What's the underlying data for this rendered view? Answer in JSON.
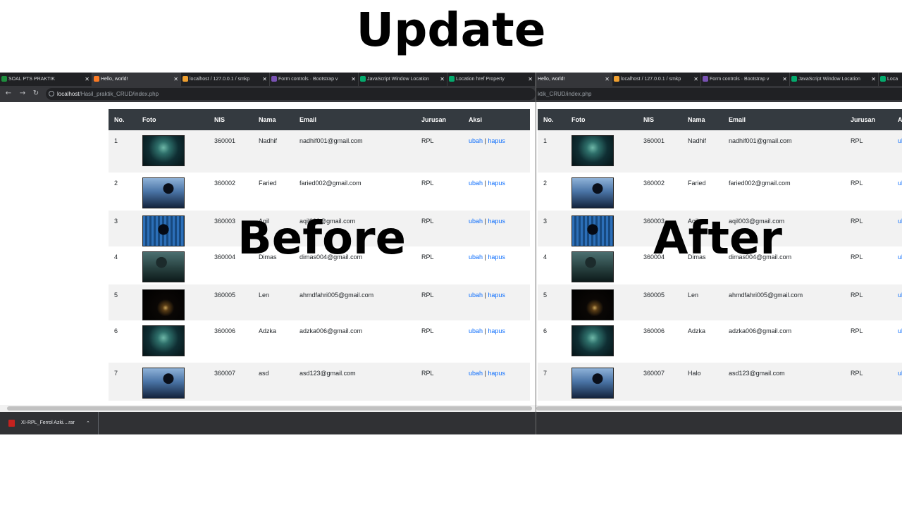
{
  "heading": "Update",
  "labels": {
    "before": "Before",
    "after": "After"
  },
  "colors": {
    "header_bg": "#343a40",
    "link": "#0d6efd",
    "stripe": "#f2f2f2",
    "browser_dark": "#202124"
  },
  "before": {
    "tabs": [
      {
        "title": "SOAL PTS PRAKTIK",
        "icon": "classroom-icon"
      },
      {
        "title": "Hello, world!",
        "icon": "xampp-icon",
        "active": true
      },
      {
        "title": "localhost / 127.0.0.1 / smkp",
        "icon": "phpmyadmin-icon"
      },
      {
        "title": "Form controls · Bootstrap v",
        "icon": "bootstrap-icon"
      },
      {
        "title": "JavaScript Window Location",
        "icon": "w3schools-icon"
      },
      {
        "title": "Location href Property",
        "icon": "w3schools-icon"
      }
    ],
    "url": {
      "host": "localhost",
      "path": "/Hasil_praktik_CRUD/index.php"
    }
  },
  "after": {
    "tabs": [
      {
        "title": "Hello, world!",
        "icon": "xampp-icon",
        "active": true
      },
      {
        "title": "localhost / 127.0.0.1 / smkp",
        "icon": "phpmyadmin-icon"
      },
      {
        "title": "Form controls · Bootstrap v",
        "icon": "bootstrap-icon"
      },
      {
        "title": "JavaScript Window Location",
        "icon": "w3schools-icon"
      },
      {
        "title": "Loca",
        "icon": "w3schools-icon"
      }
    ],
    "url": {
      "path": "ktik_CRUD/index.php"
    }
  },
  "table": {
    "headers": [
      "No.",
      "Foto",
      "NIS",
      "Nama",
      "Email",
      "Jurusan",
      "Aksi"
    ],
    "action_edit": "ubah",
    "action_sep": "|",
    "action_delete": "hapus"
  },
  "rows_before": [
    {
      "no": "1",
      "nis": "360001",
      "nama": "Nadhif",
      "email": "nadhif001@gmail.com",
      "jurusan": "RPL",
      "photo": "masked-hacker-photo"
    },
    {
      "no": "2",
      "nis": "360002",
      "nama": "Faried",
      "email": "faried002@gmail.com",
      "jurusan": "RPL",
      "photo": "hooded-hacker-laptop-photo"
    },
    {
      "no": "3",
      "nis": "360003",
      "nama": "Aqil",
      "email": "aqil003@gmail.com",
      "jurusan": "RPL",
      "photo": "hacker-code-photo"
    },
    {
      "no": "4",
      "nis": "360004",
      "nama": "Dimas",
      "email": "dimas004@gmail.com",
      "jurusan": "RPL",
      "photo": "hacker-laptops-photo"
    },
    {
      "no": "5",
      "nis": "360005",
      "nama": "Len",
      "email": "ahmdfahri005@gmail.com",
      "jurusan": "RPL",
      "photo": "dark-hacker-photo"
    },
    {
      "no": "6",
      "nis": "360006",
      "nama": "Adzka",
      "email": "adzka006@gmail.com",
      "jurusan": "RPL",
      "photo": "masked-hacker-photo"
    },
    {
      "no": "7",
      "nis": "360007",
      "nama": "asd",
      "email": "asd123@gmail.com",
      "jurusan": "RPL",
      "photo": "hooded-hacker-laptop-photo"
    }
  ],
  "rows_after": [
    {
      "no": "1",
      "nis": "360001",
      "nama": "Nadhif",
      "email": "nadhif001@gmail.com",
      "jurusan": "RPL",
      "photo": "masked-hacker-photo"
    },
    {
      "no": "2",
      "nis": "360002",
      "nama": "Faried",
      "email": "faried002@gmail.com",
      "jurusan": "RPL",
      "photo": "hooded-hacker-laptop-photo"
    },
    {
      "no": "3",
      "nis": "360003",
      "nama": "Aqil",
      "email": "aqil003@gmail.com",
      "jurusan": "RPL",
      "photo": "hacker-code-photo"
    },
    {
      "no": "4",
      "nis": "360004",
      "nama": "Dimas",
      "email": "dimas004@gmail.com",
      "jurusan": "RPL",
      "photo": "hacker-laptops-photo"
    },
    {
      "no": "5",
      "nis": "360005",
      "nama": "Len",
      "email": "ahmdfahri005@gmail.com",
      "jurusan": "RPL",
      "photo": "dark-hacker-photo"
    },
    {
      "no": "6",
      "nis": "360006",
      "nama": "Adzka",
      "email": "adzka006@gmail.com",
      "jurusan": "RPL",
      "photo": "masked-hacker-photo"
    },
    {
      "no": "7",
      "nis": "360007",
      "nama": "Halo",
      "email": "asd123@gmail.com",
      "jurusan": "RPL",
      "photo": "hooded-hacker-laptop-photo"
    }
  ],
  "download": {
    "filename": "XI-RPL_Ferrol Azki....rar",
    "icon": "winrar-archive-icon"
  }
}
